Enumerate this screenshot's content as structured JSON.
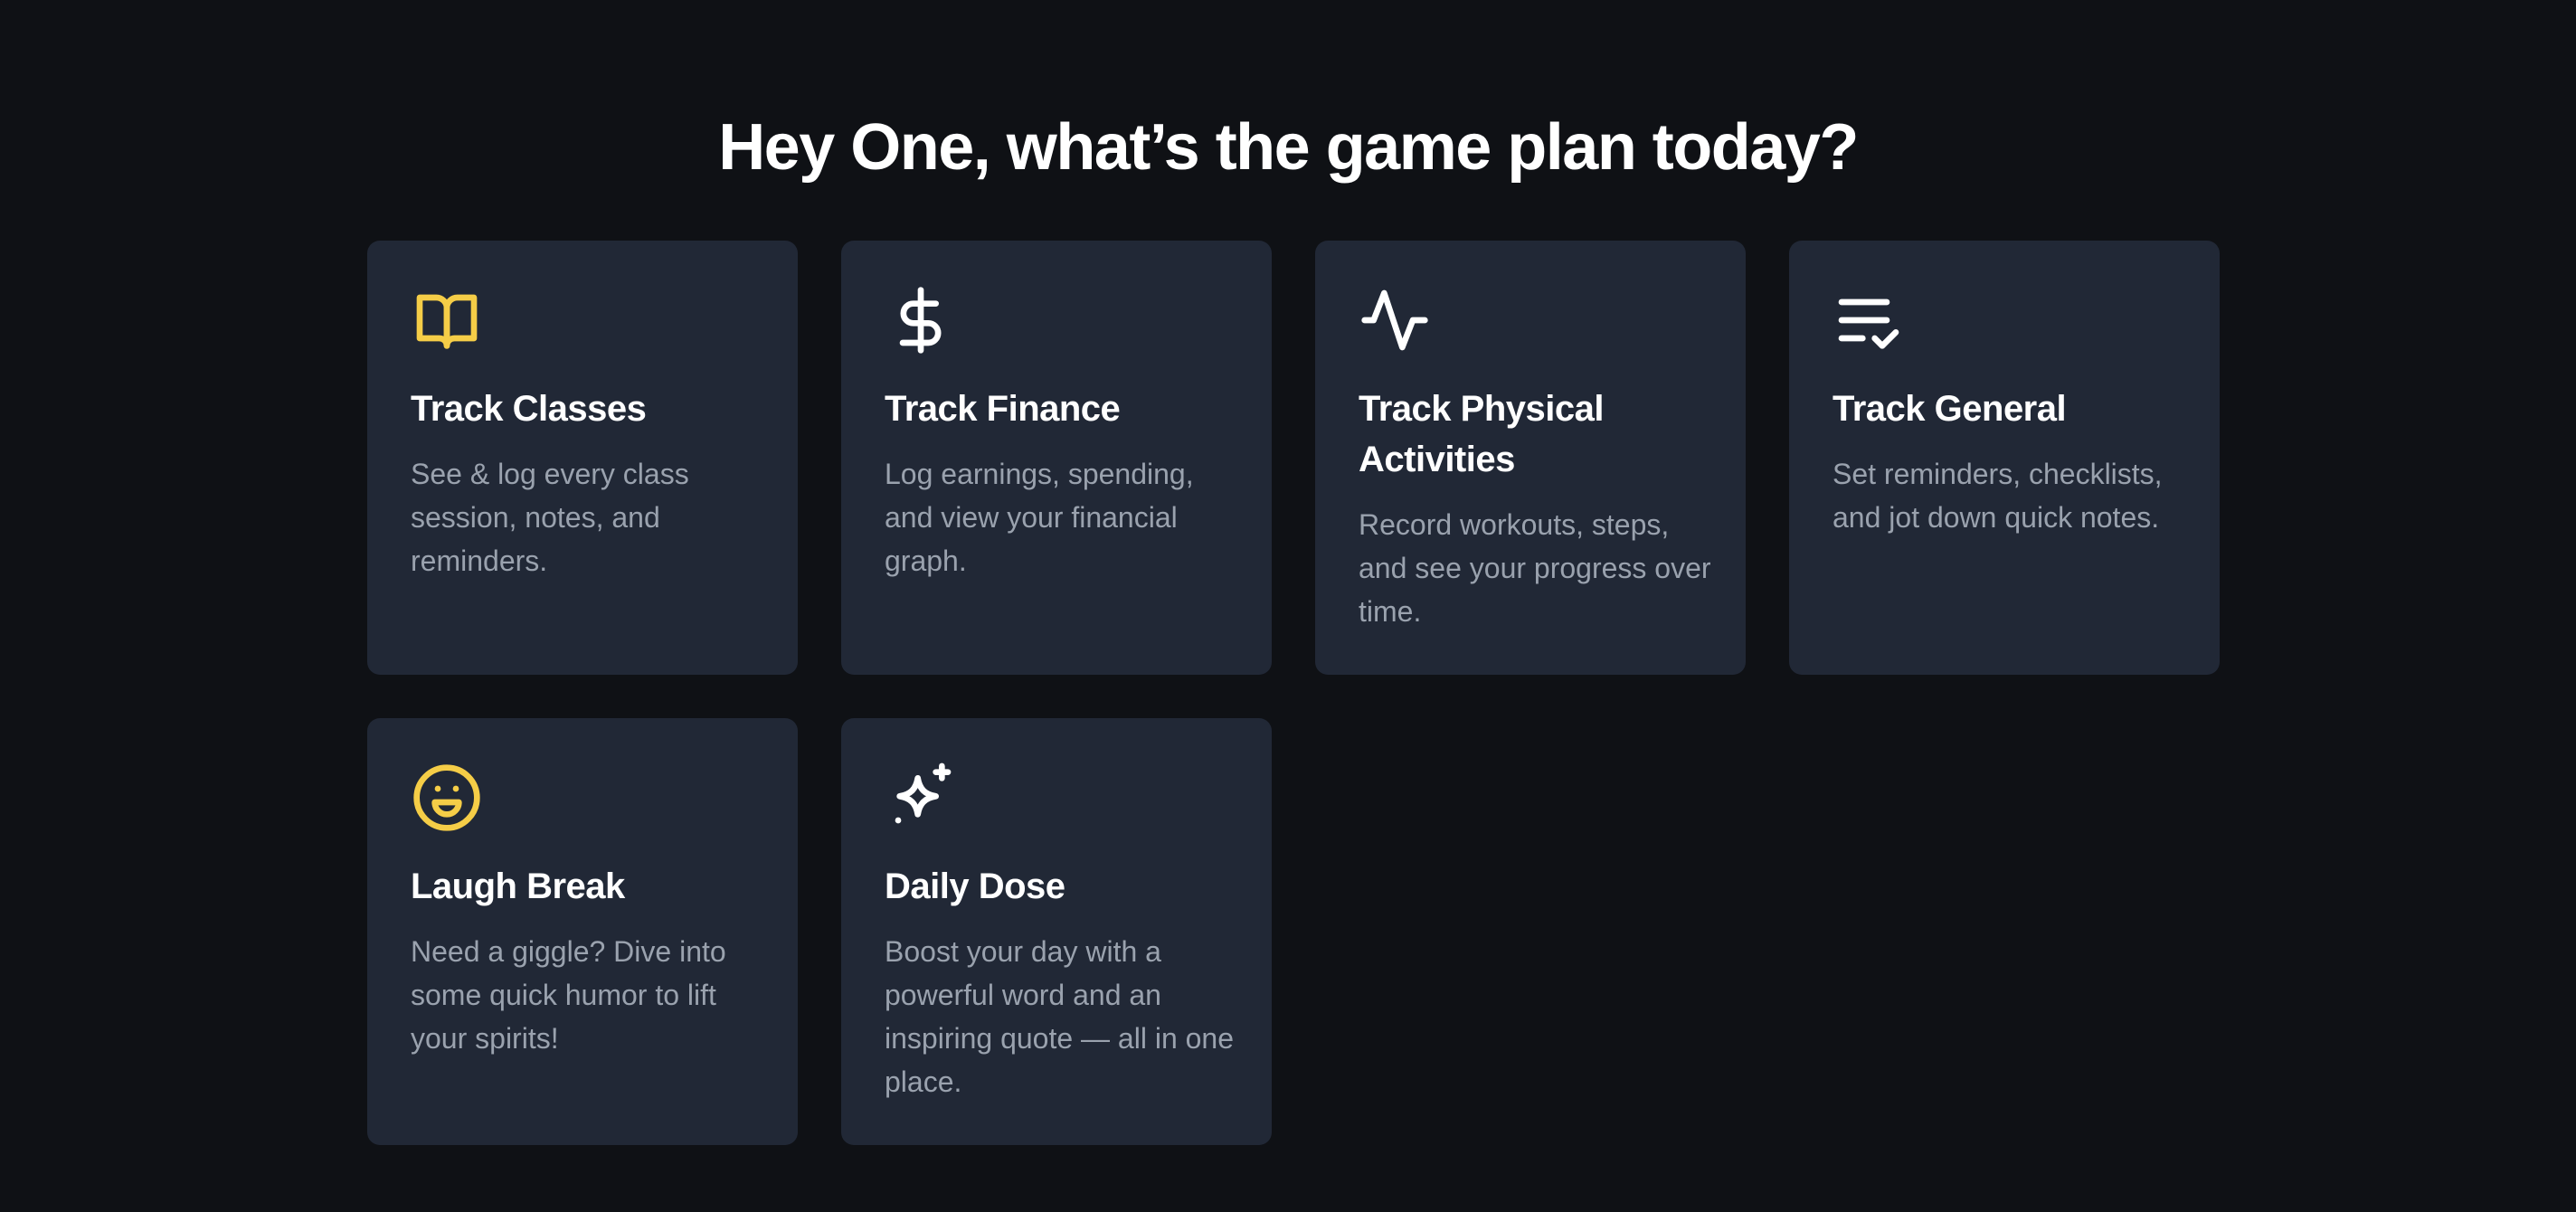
{
  "greeting": "Hey One, what’s the game plan today?",
  "colors": {
    "background": "#0f1115",
    "card": "#212836",
    "accent_yellow": "#f5cd47",
    "text_primary": "#ffffff",
    "text_muted": "#9aa2ae"
  },
  "cards": [
    {
      "icon": "book-open-icon",
      "title": "Track Classes",
      "description": "See & log every class session, notes, and reminders."
    },
    {
      "icon": "dollar-icon",
      "title": "Track Finance",
      "description": "Log earnings, spending, and view your financial graph."
    },
    {
      "icon": "activity-icon",
      "title": "Track Physical Activities",
      "description": "Record workouts, steps, and see your progress over time."
    },
    {
      "icon": "list-check-icon",
      "title": "Track General",
      "description": "Set reminders, checklists, and jot down quick notes."
    },
    {
      "icon": "laugh-icon",
      "title": "Laugh Break",
      "description": "Need a giggle? Dive into some quick humor to lift your spirits!"
    },
    {
      "icon": "sparkles-icon",
      "title": "Daily Dose",
      "description": "Boost your day with a powerful word and an inspiring quote — all in one place."
    }
  ]
}
